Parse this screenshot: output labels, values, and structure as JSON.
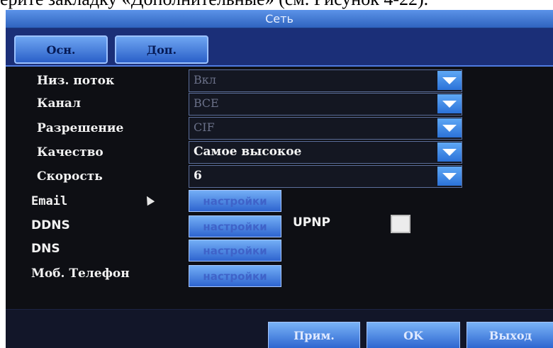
{
  "caption": "ерите закладку «Дополнительные» (см. Рисунок 4-22).",
  "window": {
    "title": "Сеть"
  },
  "tabs": [
    {
      "label": "Осн."
    },
    {
      "label": "Доп."
    }
  ],
  "fields": [
    {
      "label": "Низ. поток",
      "value": "Вкл",
      "enabled": false
    },
    {
      "label": "Канал",
      "value": "ВСЕ",
      "enabled": false
    },
    {
      "label": "Разрешение",
      "value": "CIF",
      "enabled": false
    },
    {
      "label": "Качество",
      "value": "Самое высокое",
      "enabled": true
    },
    {
      "label": "Скорость",
      "value": "6",
      "enabled": true
    }
  ],
  "services": [
    {
      "label": "Email",
      "button": "настройки"
    },
    {
      "label": "DDNS",
      "button": "настройки"
    },
    {
      "label": "DNS",
      "button": "настройки"
    },
    {
      "label": "Моб. Телефон",
      "button": "настройки"
    }
  ],
  "upnp": {
    "label": "UPNP",
    "checked": false
  },
  "footer": {
    "apply": "Прим.",
    "ok": "OK",
    "exit": "Выход"
  },
  "colors": {
    "title_bar": "#3f78d6",
    "tab_bar": "#1b2f78",
    "button": "#2e64cf",
    "background": "#0e0f14"
  }
}
